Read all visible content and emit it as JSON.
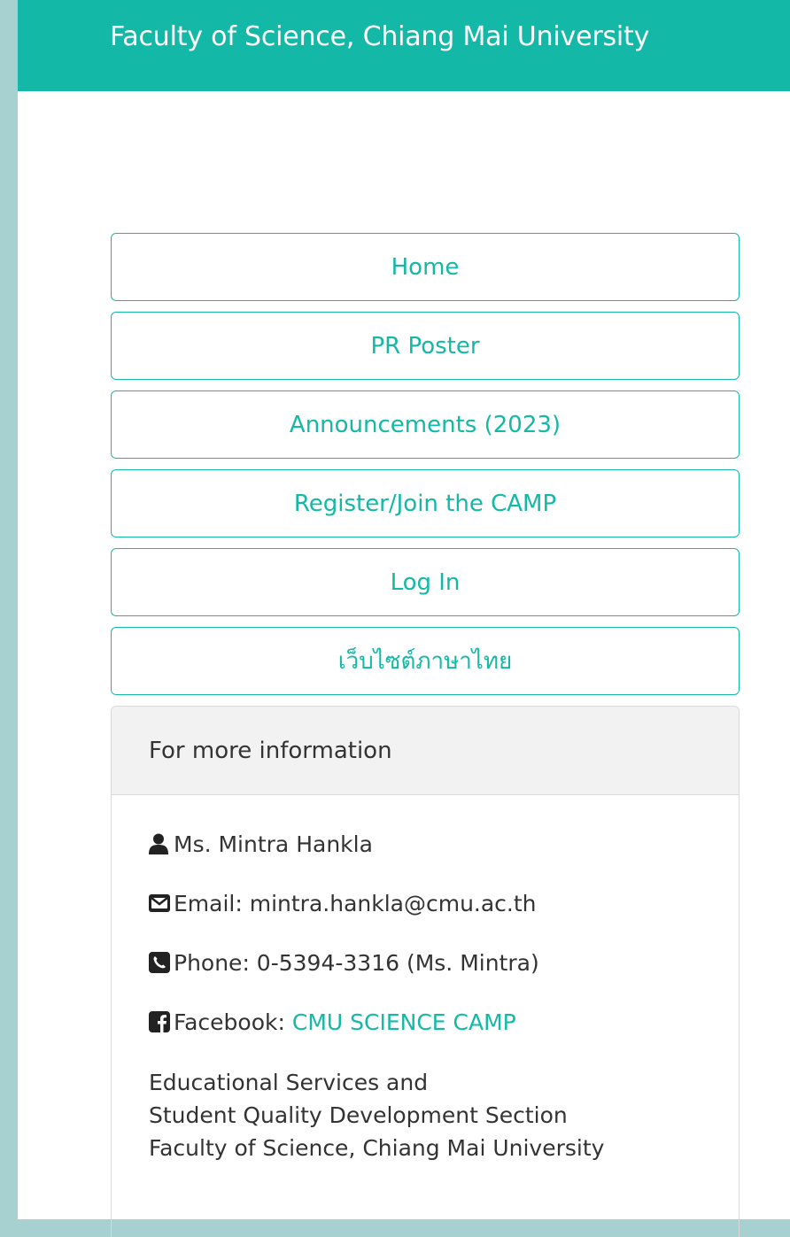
{
  "header": {
    "title": "Faculty of Science, Chiang Mai University"
  },
  "nav": {
    "items": [
      {
        "label": "Home"
      },
      {
        "label": "PR Poster"
      },
      {
        "label": "Announcements (2023)"
      },
      {
        "label": "Register/Join the CAMP"
      },
      {
        "label": "Log In"
      },
      {
        "label": "เว็บไซต์ภาษาไทย"
      }
    ]
  },
  "info": {
    "heading": "For more information",
    "contact_name": "Ms. Mintra Hankla",
    "email": "Email: mintra.hankla@cmu.ac.th",
    "phone": "Phone: 0-5394-3316 (Ms. Mintra)",
    "facebook_label": "Facebook: ",
    "facebook_link": "CMU SCIENCE CAMP",
    "address_lines": [
      "Educational Services and",
      "Student Quality Development Section",
      "Faculty of Science, Chiang Mai University"
    ]
  },
  "colors": {
    "accent": "#14b8a6",
    "sidebar": "#a7d0d0",
    "marker": "#e53935"
  },
  "icons": [
    "user-icon",
    "envelope-icon",
    "phone-icon",
    "facebook-icon"
  ]
}
